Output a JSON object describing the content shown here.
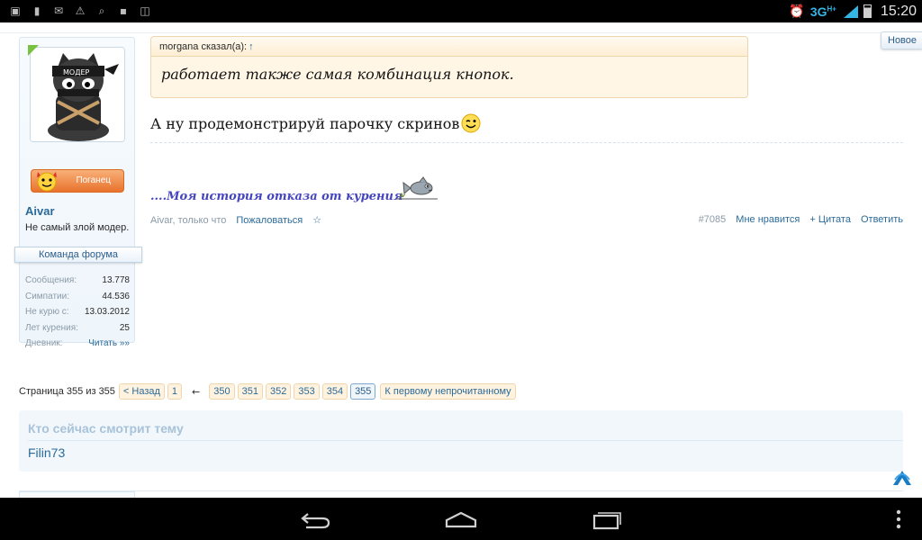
{
  "status_bar": {
    "left_icons": [
      "gallery-icon",
      "sim-icon",
      "mail-icon",
      "warning-icon",
      "search-icon",
      "lock-icon",
      "bag-icon"
    ],
    "network": "3G",
    "network_sup": "H+",
    "time": "15:20",
    "colors": {
      "accent": "#33b5e5"
    }
  },
  "top_button": {
    "label": "Новое"
  },
  "member": {
    "username": "Aivar",
    "title": "Не самый злой модер.",
    "badge": "Поганец",
    "staff": "Команда форума",
    "stats": [
      {
        "key": "Сообщения:",
        "value": "13.778"
      },
      {
        "key": "Симпатии:",
        "value": "44.536"
      },
      {
        "key": "Не курю с:",
        "value": "13.03.2012"
      },
      {
        "key": "Лет курения:",
        "value": "25"
      },
      {
        "key": "Дневник:",
        "value": "Читать »»"
      }
    ]
  },
  "post": {
    "quote_author": "morgana сказал(а):",
    "quote_text": "работает также самая комбинация кнопок.",
    "message": "А ну продемонстрируй парочку скринов",
    "signature": "....Моя история отказа от курения",
    "meta": {
      "author_time": "Aivar, только что",
      "report": "Пожаловаться",
      "star": "☆",
      "number": "#7085",
      "like": "Мне нравится",
      "quote": "+ Цитата",
      "reply": "Ответить"
    }
  },
  "pagination": {
    "label": "Страница 355 из 355",
    "prev": "< Назад",
    "first": "1",
    "arrow": "←",
    "pages": [
      "350",
      "351",
      "352",
      "353",
      "354",
      "355"
    ],
    "current": "355",
    "unread": "К первому непрочитанному"
  },
  "viewers": {
    "title": "Кто сейчас смотрит тему",
    "users": "Filin73"
  }
}
